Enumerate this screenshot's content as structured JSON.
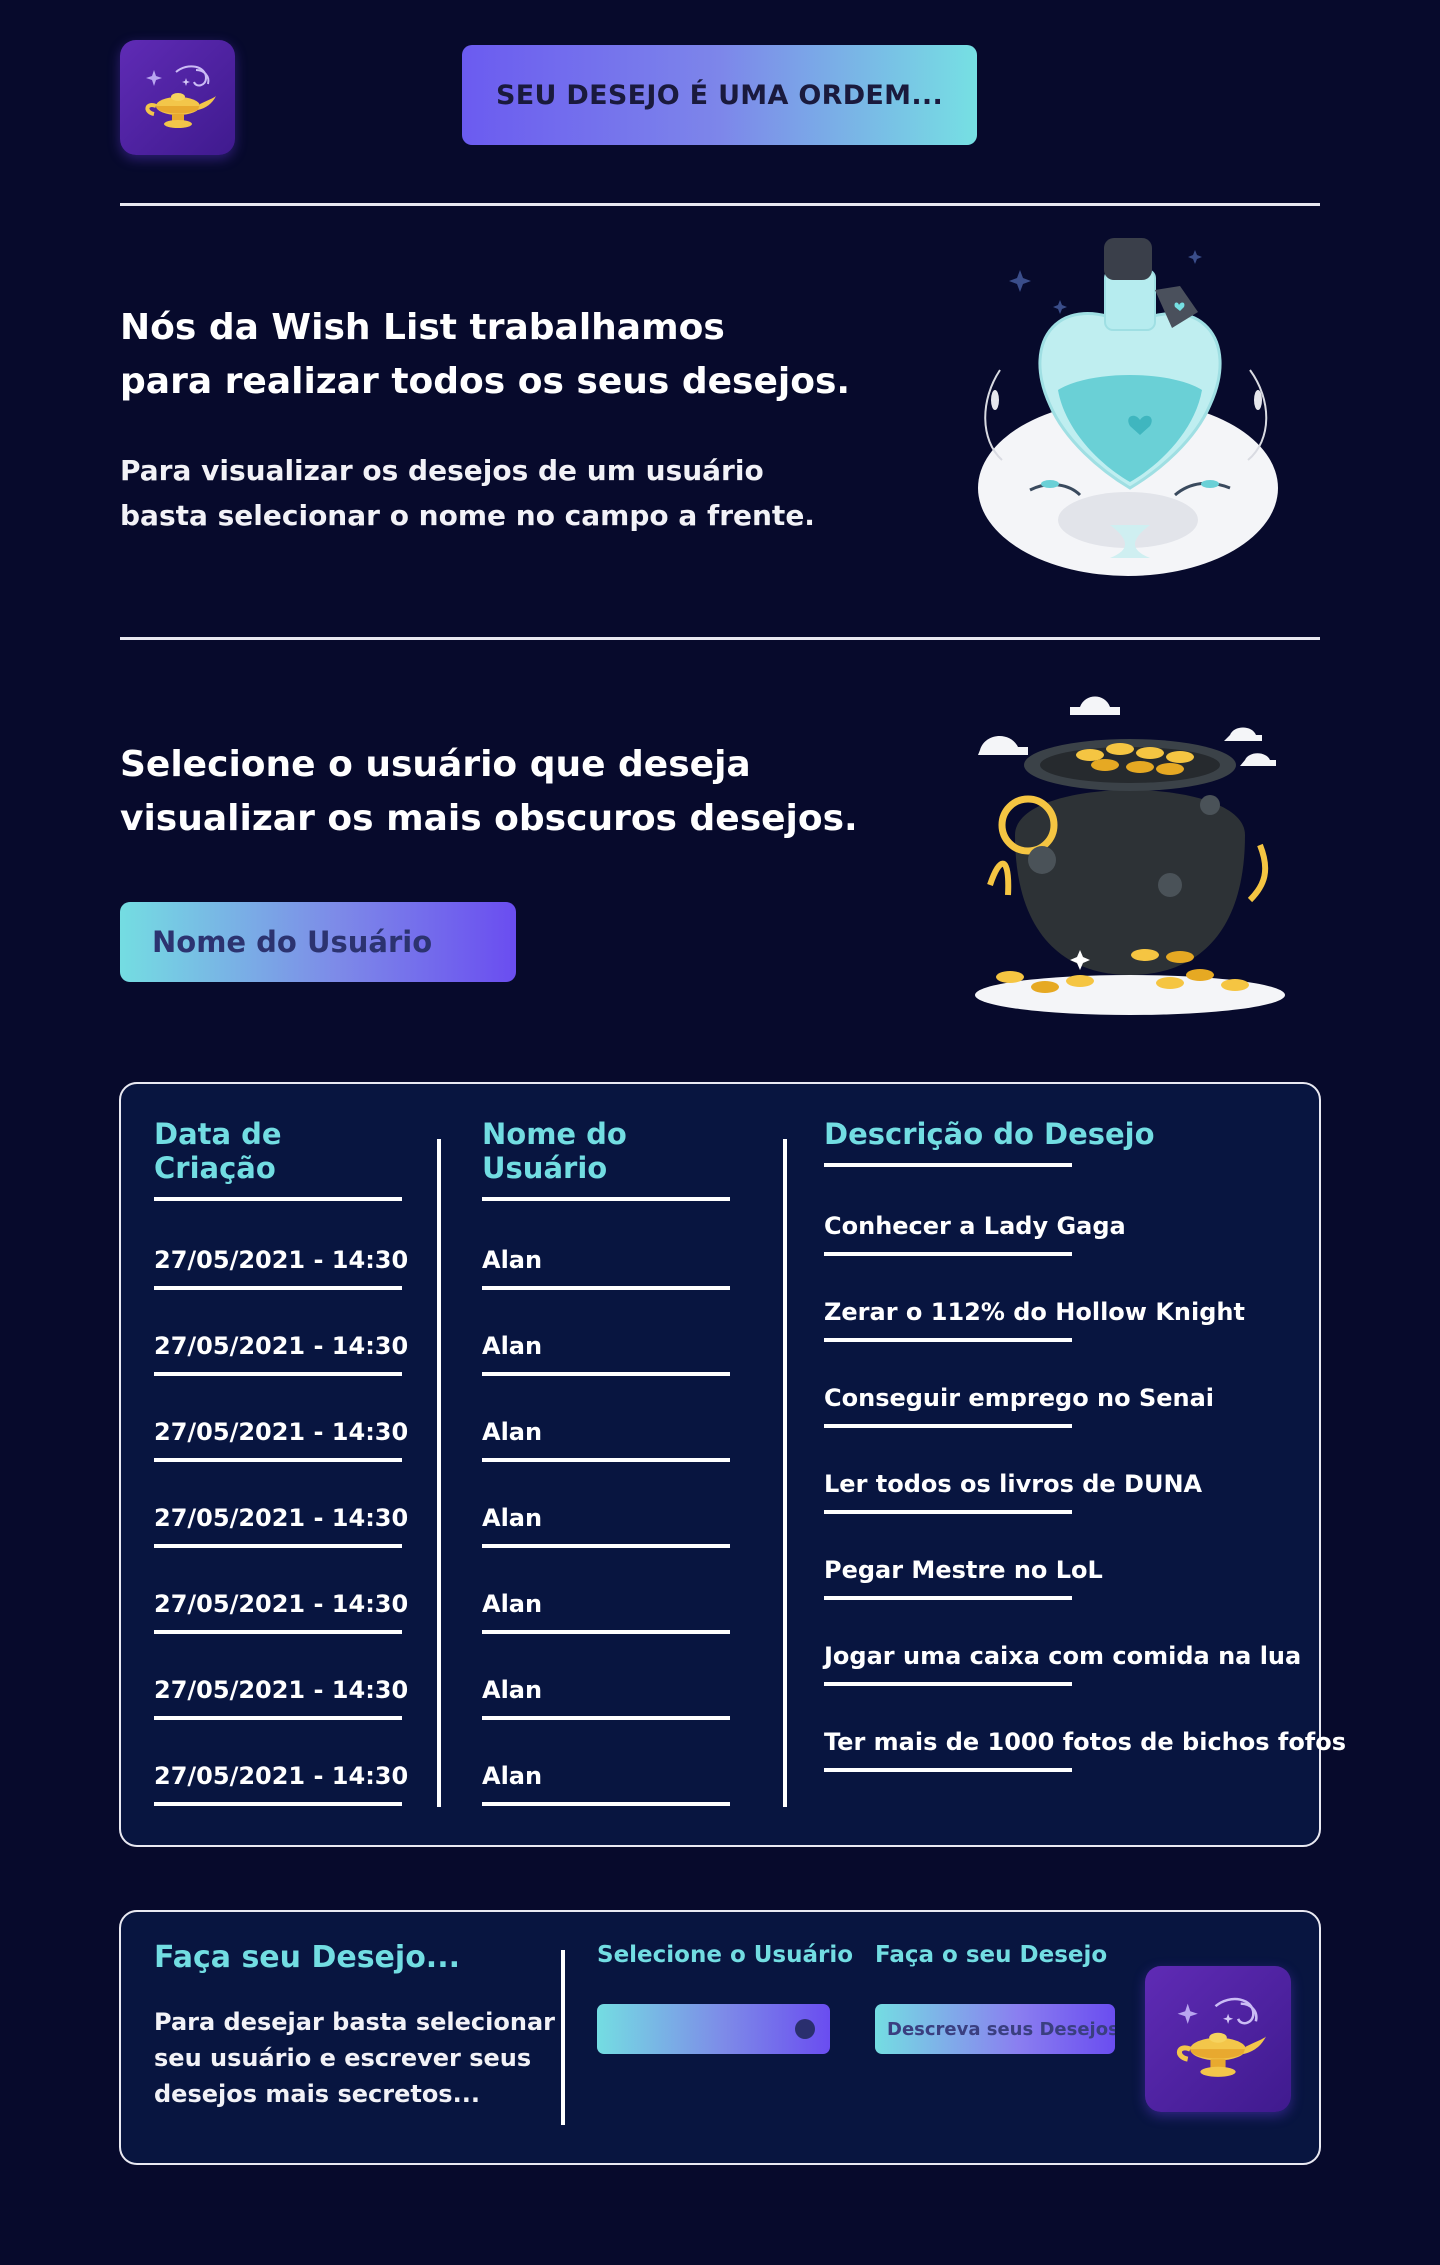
{
  "header": {
    "logo_icon": "magic-lamp-icon",
    "cta_label": "SEU DESEJO É UMA ORDEM..."
  },
  "intro": {
    "headline_line1": "Nós da Wish List trabalhamos",
    "headline_line2": "para realizar todos os seus desejos.",
    "sub_line1": "Para visualizar os desejos de um usuário",
    "sub_line2": "basta selecionar o nome no campo a frente.",
    "illustration": "potion-bottle-illustration"
  },
  "select_section": {
    "headline_line1": "Selecione o usuário que deseja",
    "headline_line2": "visualizar os mais obscuros desejos.",
    "select_value": "Nome do Usuário",
    "illustration": "gold-cauldron-illustration"
  },
  "table": {
    "headers": [
      "Data de Criação",
      "Nome do Usuário",
      "Descrição do Desejo"
    ],
    "rows": [
      {
        "date": "27/05/2021 - 14:30",
        "user": "Alan",
        "wish": "Conhecer a Lady Gaga"
      },
      {
        "date": "27/05/2021 - 14:30",
        "user": "Alan",
        "wish": "Zerar o 112% do Hollow Knight"
      },
      {
        "date": "27/05/2021 - 14:30",
        "user": "Alan",
        "wish": "Conseguir emprego no Senai"
      },
      {
        "date": "27/05/2021 - 14:30",
        "user": "Alan",
        "wish": "Ler todos os livros de DUNA"
      },
      {
        "date": "27/05/2021 - 14:30",
        "user": "Alan",
        "wish": "Pegar Mestre no LoL"
      },
      {
        "date": "27/05/2021 - 14:30",
        "user": "Alan",
        "wish": "Jogar uma caixa com comida na lua"
      },
      {
        "date": "27/05/2021 - 14:30",
        "user": "Alan",
        "wish": "Ter mais de 1000 fotos de bichos fofos"
      }
    ]
  },
  "wish_form": {
    "title": "Faça seu Desejo...",
    "text_line1": "Para desejar basta selecionar",
    "text_line2": "seu usuário e escrever seus",
    "text_line3": "desejos mais secretos...",
    "select_label": "Selecione o Usuário",
    "wish_label": "Faça o seu Desejo",
    "wish_placeholder": "Descreva seus Desejos",
    "submit_icon": "magic-lamp-icon"
  },
  "colors": {
    "background": "#070a2c",
    "accent_teal": "#72dde2",
    "accent_purple": "#6a4df0",
    "card_bg": "#081540"
  }
}
